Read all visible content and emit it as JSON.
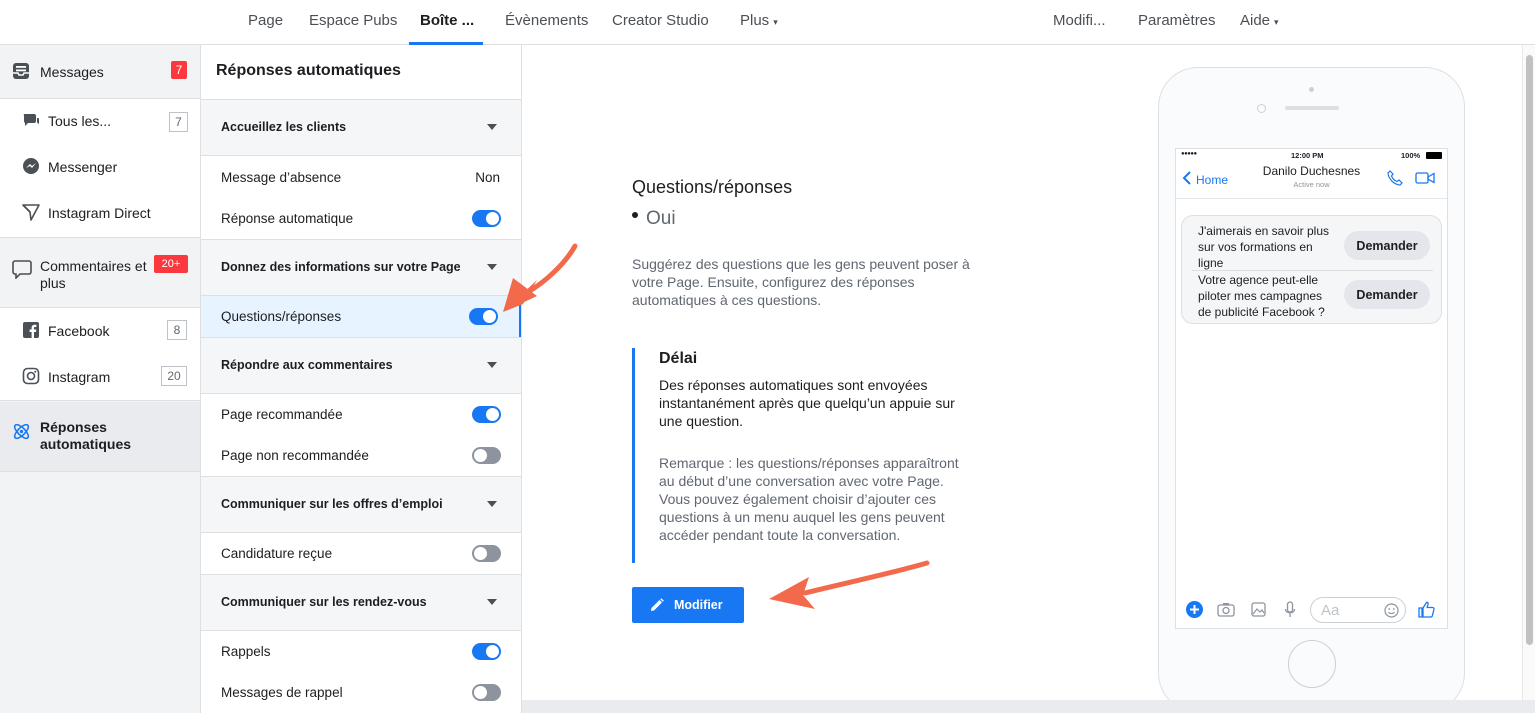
{
  "topnav": {
    "items": [
      {
        "label": "Page",
        "active": false
      },
      {
        "label": "Espace Pubs",
        "active": false
      },
      {
        "label": "Boîte ...",
        "active": true
      },
      {
        "label": "Évènements",
        "active": false
      },
      {
        "label": "Creator Studio",
        "active": false
      },
      {
        "label": "Plus",
        "active": false,
        "has_caret": true
      }
    ],
    "right_items": [
      {
        "label": "Modifi..."
      },
      {
        "label": "Paramètres"
      },
      {
        "label": "Aide",
        "has_caret": true
      }
    ],
    "caret": "▾"
  },
  "sidebar": {
    "messages": {
      "label": "Messages",
      "badge": "7",
      "icon": "inbox-icon"
    },
    "tous": {
      "label": "Tous les...",
      "badge": "7",
      "icon": "chat-bubbles-icon"
    },
    "messenger": {
      "label": "Messenger",
      "icon": "messenger-icon"
    },
    "instagram_direct": {
      "label": "Instagram Direct",
      "icon": "instagram-direct-icon"
    },
    "comments": {
      "label": "Commentaires et plus",
      "badge": "20+",
      "icon": "comment-icon"
    },
    "facebook": {
      "label": "Facebook",
      "badge": "8",
      "icon": "facebook-icon"
    },
    "instagram": {
      "label": "Instagram",
      "badge": "20",
      "icon": "instagram-icon"
    },
    "auto": {
      "label": "Réponses automatiques",
      "icon": "automation-icon"
    }
  },
  "settings": {
    "title": "Réponses automatiques",
    "sections": [
      {
        "label": "Accueillez les clients"
      },
      {
        "label": "Donnez des informations sur votre Page"
      },
      {
        "label": "Répondre aux commentaires"
      },
      {
        "label": "Communiquer sur les offres d’emploi"
      },
      {
        "label": "Communiquer sur les rendez-vous"
      }
    ],
    "rows": [
      {
        "label": "Message d’absence",
        "value": "Non"
      },
      {
        "label": "Réponse automatique",
        "on": true
      },
      {
        "label": "Questions/réponses",
        "on": true,
        "selected": true
      },
      {
        "label": "Page recommandée",
        "on": true
      },
      {
        "label": "Page non recommandée",
        "on": false
      },
      {
        "label": "Candidature reçue",
        "on": false
      },
      {
        "label": "Rappels",
        "on": true
      },
      {
        "label": "Messages de rappel",
        "on": false
      }
    ]
  },
  "detail": {
    "title": "Questions/réponses",
    "status": "Oui",
    "description": "Suggérez des questions que les gens peuvent poser à votre Page. Ensuite, configurez des réponses automatiques à ces questions.",
    "delay_title": "Délai",
    "delay_text": "Des réponses automatiques sont envoyées instantanément après que quelqu’un appuie sur une question.",
    "note": "Remarque : les questions/réponses apparaîtront au début d’une conversation avec votre Page. Vous pouvez également choisir d’ajouter ces questions à un menu auquel les gens peuvent accéder pendant toute la conversation.",
    "edit_button": "Modifier"
  },
  "phone": {
    "time": "12:00 PM",
    "battery": "100%",
    "signal": "●●●●●",
    "back": "Home",
    "contact_name": "Danilo Duchesnes",
    "contact_status": "Active now",
    "questions": [
      {
        "text": "J'aimerais en savoir plus sur vos formations en ligne",
        "button": "Demander"
      },
      {
        "text": "Votre agence peut-elle piloter mes campagnes de publicité Facebook ?",
        "button": "Demander"
      }
    ],
    "composer_placeholder": "Aa"
  },
  "colors": {
    "accent": "#1877f2",
    "badge_red": "#fa383e",
    "arrow": "#f26a4b"
  }
}
